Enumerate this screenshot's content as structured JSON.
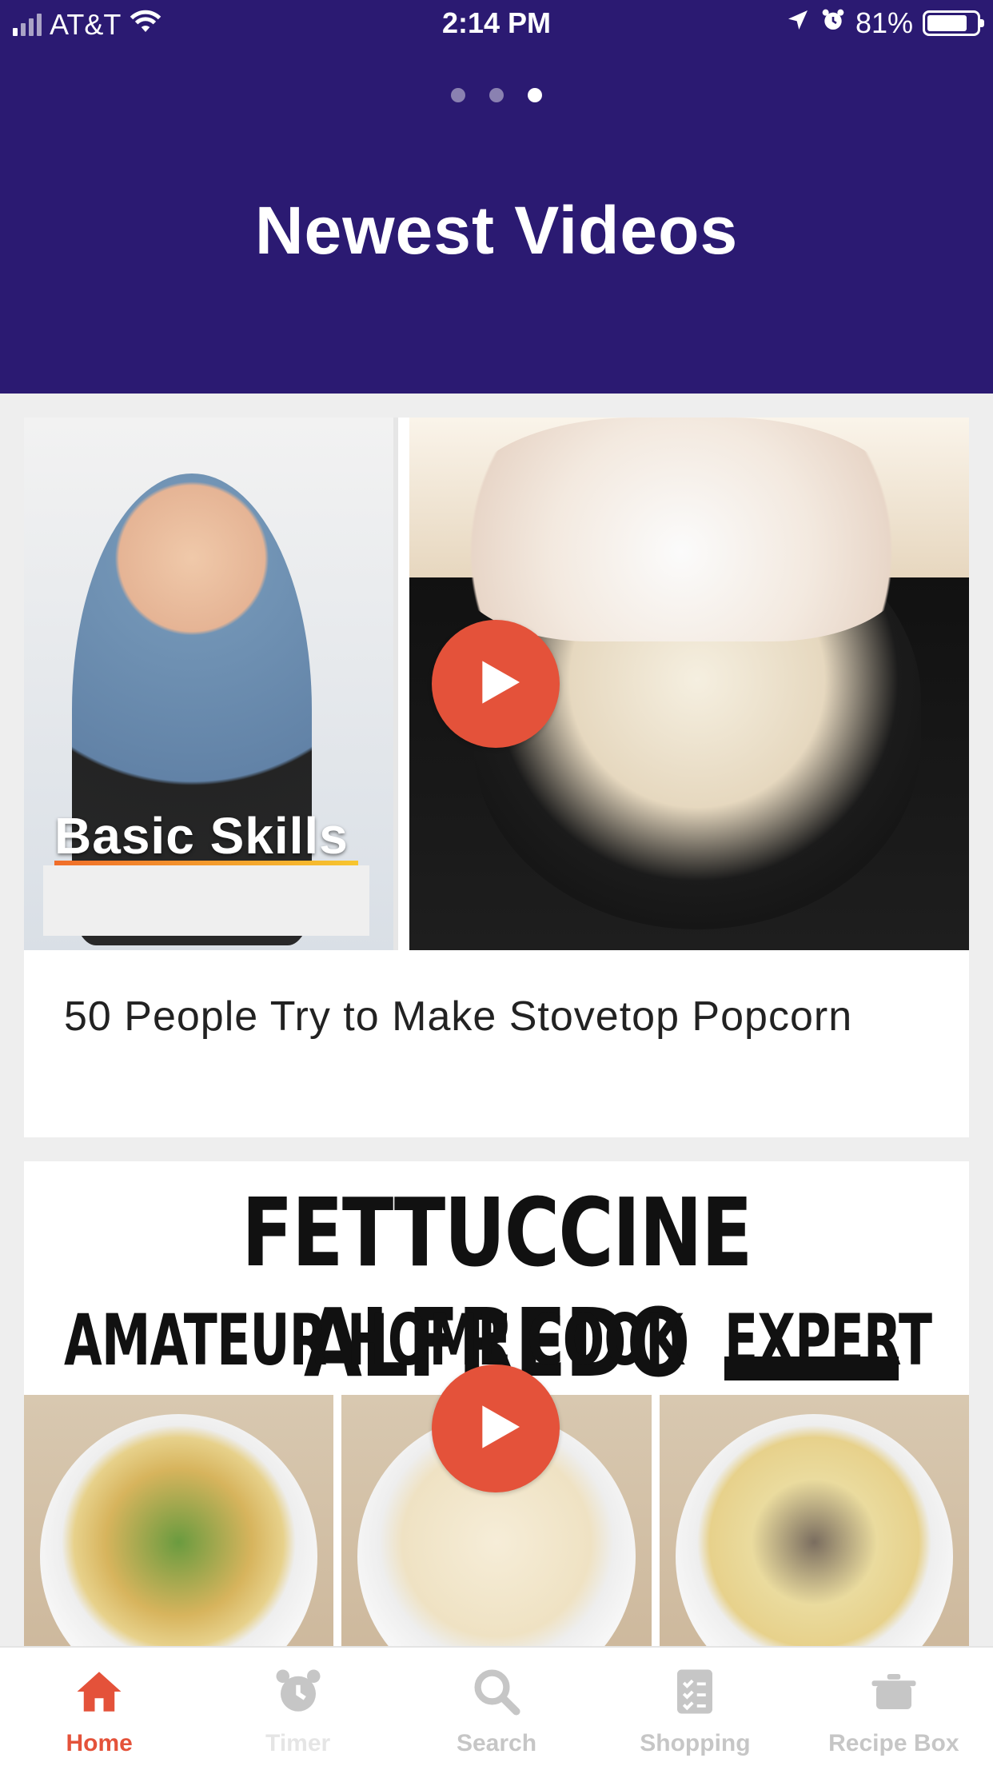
{
  "status_bar": {
    "carrier": "AT&T",
    "time": "2:14 PM",
    "battery_percent": "81%",
    "battery_level": 0.81,
    "icons": [
      "signal-icon",
      "wifi-icon",
      "location-icon",
      "alarm-icon",
      "battery-icon"
    ]
  },
  "header": {
    "pager": {
      "count": 3,
      "active_index": 2
    },
    "title": "Newest Videos",
    "background_color": "#2b1a72"
  },
  "videos": [
    {
      "title": "50 People Try to Make Stovetop Popcorn",
      "thumbnail_text": "Basic Skills",
      "play_icon": "play-icon"
    },
    {
      "thumbnail_title": "FETTUCCINE ALFREDO",
      "thumbnail_labels": [
        "AMATEUR",
        "HOME COOK",
        "EXPERT"
      ],
      "play_icon": "play-icon"
    }
  ],
  "tabbar": {
    "items": [
      {
        "label": "Home",
        "icon": "home-icon",
        "active": true
      },
      {
        "label": "Timer",
        "icon": "alarm-clock-icon",
        "active": false
      },
      {
        "label": "Search",
        "icon": "search-icon",
        "active": false
      },
      {
        "label": "Shopping",
        "icon": "checklist-icon",
        "active": false
      },
      {
        "label": "Recipe Box",
        "icon": "pot-icon",
        "active": false
      }
    ],
    "active_color": "#e4523a",
    "inactive_color": "#c6c6c6"
  },
  "accent_color": "#e4523a"
}
